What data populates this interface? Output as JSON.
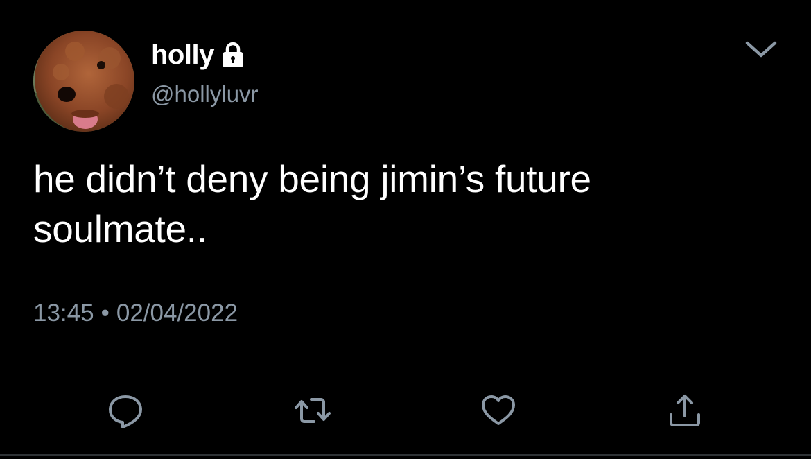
{
  "tweet": {
    "display_name": "holly",
    "handle": "@hollyluvr",
    "text": "he didn’t deny being jimin’s future\nsoulmate..",
    "time": "13:45",
    "separator": "•",
    "date": "02/04/2022"
  },
  "icons": {
    "avatar": "dog-avatar",
    "protected": "lock-icon",
    "menu": "chevron-down-icon",
    "reply": "reply-icon",
    "retweet": "retweet-icon",
    "like": "heart-icon",
    "share": "share-icon"
  },
  "colors": {
    "background": "#000000",
    "text_primary": "#ffffff",
    "text_secondary": "#8b98a5",
    "divider": "#38444d"
  }
}
